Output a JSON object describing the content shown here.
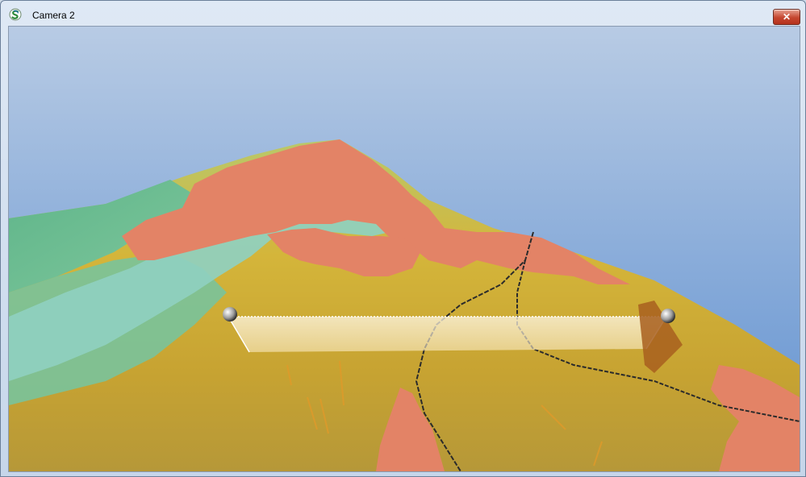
{
  "window": {
    "title": "Camera 2",
    "close_glyph": "✕"
  },
  "icons": {
    "app": "app-logo-icon",
    "close": "close-icon"
  },
  "colors": {
    "sky_top": "#9fb7d8",
    "sky_horizon": "#6e99d1",
    "urban_zone": "#e38366",
    "water_zone": "#8fd0c0",
    "green_terrain": "#66b88a",
    "yellow_terrain": "#c9b233",
    "measure_box": "#fff6dc"
  }
}
